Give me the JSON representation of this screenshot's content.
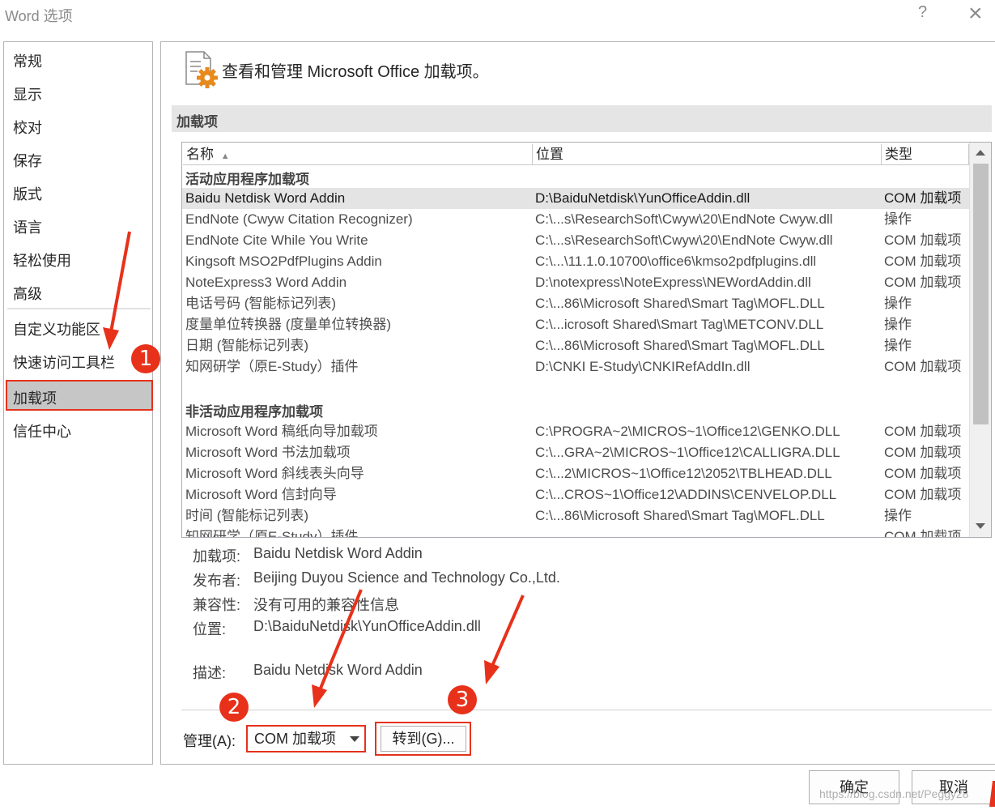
{
  "window": {
    "title": "Word 选项",
    "help_glyph": "?",
    "close_glyph": "×"
  },
  "nav": {
    "items": [
      "常规",
      "显示",
      "校对",
      "保存",
      "版式",
      "语言",
      "轻松使用",
      "高级",
      "自定义功能区",
      "快速访问工具栏",
      "加载项",
      "信任中心"
    ],
    "selected": "加载项"
  },
  "header": {
    "title": "查看和管理 Microsoft Office 加载项。"
  },
  "section": {
    "label": "加载项"
  },
  "table": {
    "columns": [
      "名称",
      "位置",
      "类型"
    ],
    "sort_glyph": "▲",
    "active_group": "活动应用程序加载项",
    "active_rows": [
      {
        "name": "Baidu Netdisk Word Addin",
        "location": "D:\\BaiduNetdisk\\YunOfficeAddin.dll",
        "type": "COM 加载项"
      },
      {
        "name": "EndNote (Cwyw Citation Recognizer)",
        "location": "C:\\...s\\ResearchSoft\\Cwyw\\20\\EndNote Cwyw.dll",
        "type": "操作"
      },
      {
        "name": "EndNote Cite While You Write",
        "location": "C:\\...s\\ResearchSoft\\Cwyw\\20\\EndNote Cwyw.dll",
        "type": "COM 加载项"
      },
      {
        "name": "Kingsoft MSO2PdfPlugins Addin",
        "location": "C:\\...\\11.1.0.10700\\office6\\kmso2pdfplugins.dll",
        "type": "COM 加载项"
      },
      {
        "name": "NoteExpress3 Word Addin",
        "location": "D:\\notexpress\\NoteExpress\\NEWordAddin.dll",
        "type": "COM 加载项"
      },
      {
        "name": "电话号码 (智能标记列表)",
        "location": "C:\\...86\\Microsoft Shared\\Smart Tag\\MOFL.DLL",
        "type": "操作"
      },
      {
        "name": "度量单位转换器 (度量单位转换器)",
        "location": "C:\\...icrosoft Shared\\Smart Tag\\METCONV.DLL",
        "type": "操作"
      },
      {
        "name": "日期 (智能标记列表)",
        "location": "C:\\...86\\Microsoft Shared\\Smart Tag\\MOFL.DLL",
        "type": "操作"
      },
      {
        "name": "知网研学（原E-Study）插件",
        "location": "D:\\CNKI E-Study\\CNKIRefAddIn.dll",
        "type": "COM 加载项"
      }
    ],
    "inactive_group": "非活动应用程序加载项",
    "inactive_rows": [
      {
        "name": "Microsoft Word 稿纸向导加载项",
        "location": "C:\\PROGRA~2\\MICROS~1\\Office12\\GENKO.DLL",
        "type": "COM 加载项"
      },
      {
        "name": "Microsoft Word 书法加载项",
        "location": "C:\\...GRA~2\\MICROS~1\\Office12\\CALLIGRA.DLL",
        "type": "COM 加载项"
      },
      {
        "name": "Microsoft Word 斜线表头向导",
        "location": "C:\\...2\\MICROS~1\\Office12\\2052\\TBLHEAD.DLL",
        "type": "COM 加载项"
      },
      {
        "name": "Microsoft Word 信封向导",
        "location": "C:\\...CROS~1\\Office12\\ADDINS\\CENVELOP.DLL",
        "type": "COM 加载项"
      },
      {
        "name": "时间 (智能标记列表)",
        "location": "C:\\...86\\Microsoft Shared\\Smart Tag\\MOFL.DLL",
        "type": "操作"
      },
      {
        "name": "知网研学（原E-Study）插件",
        "location": "",
        "type": "COM 加载项"
      }
    ]
  },
  "details": {
    "addin_label": "加载项:",
    "addin_value": "Baidu Netdisk Word Addin",
    "publisher_label": "发布者:",
    "publisher_value": "Beijing Duyou Science and Technology Co.,Ltd.",
    "compat_label": "兼容性:",
    "compat_value": "没有可用的兼容性信息",
    "location_label": "位置:",
    "location_value": "D:\\BaiduNetdisk\\YunOfficeAddin.dll",
    "desc_label": "描述:",
    "desc_value": "Baidu Netdisk Word Addin"
  },
  "manage": {
    "label": "管理(A):",
    "selected": "COM 加载项",
    "go_label": "转到(G)..."
  },
  "footer": {
    "ok_label": "确定",
    "cancel_label": "取消",
    "watermark": "https://blog.csdn.net/Peggy28"
  },
  "annotations": {
    "badges": [
      "1",
      "2",
      "3"
    ],
    "color": "#e8311a"
  }
}
